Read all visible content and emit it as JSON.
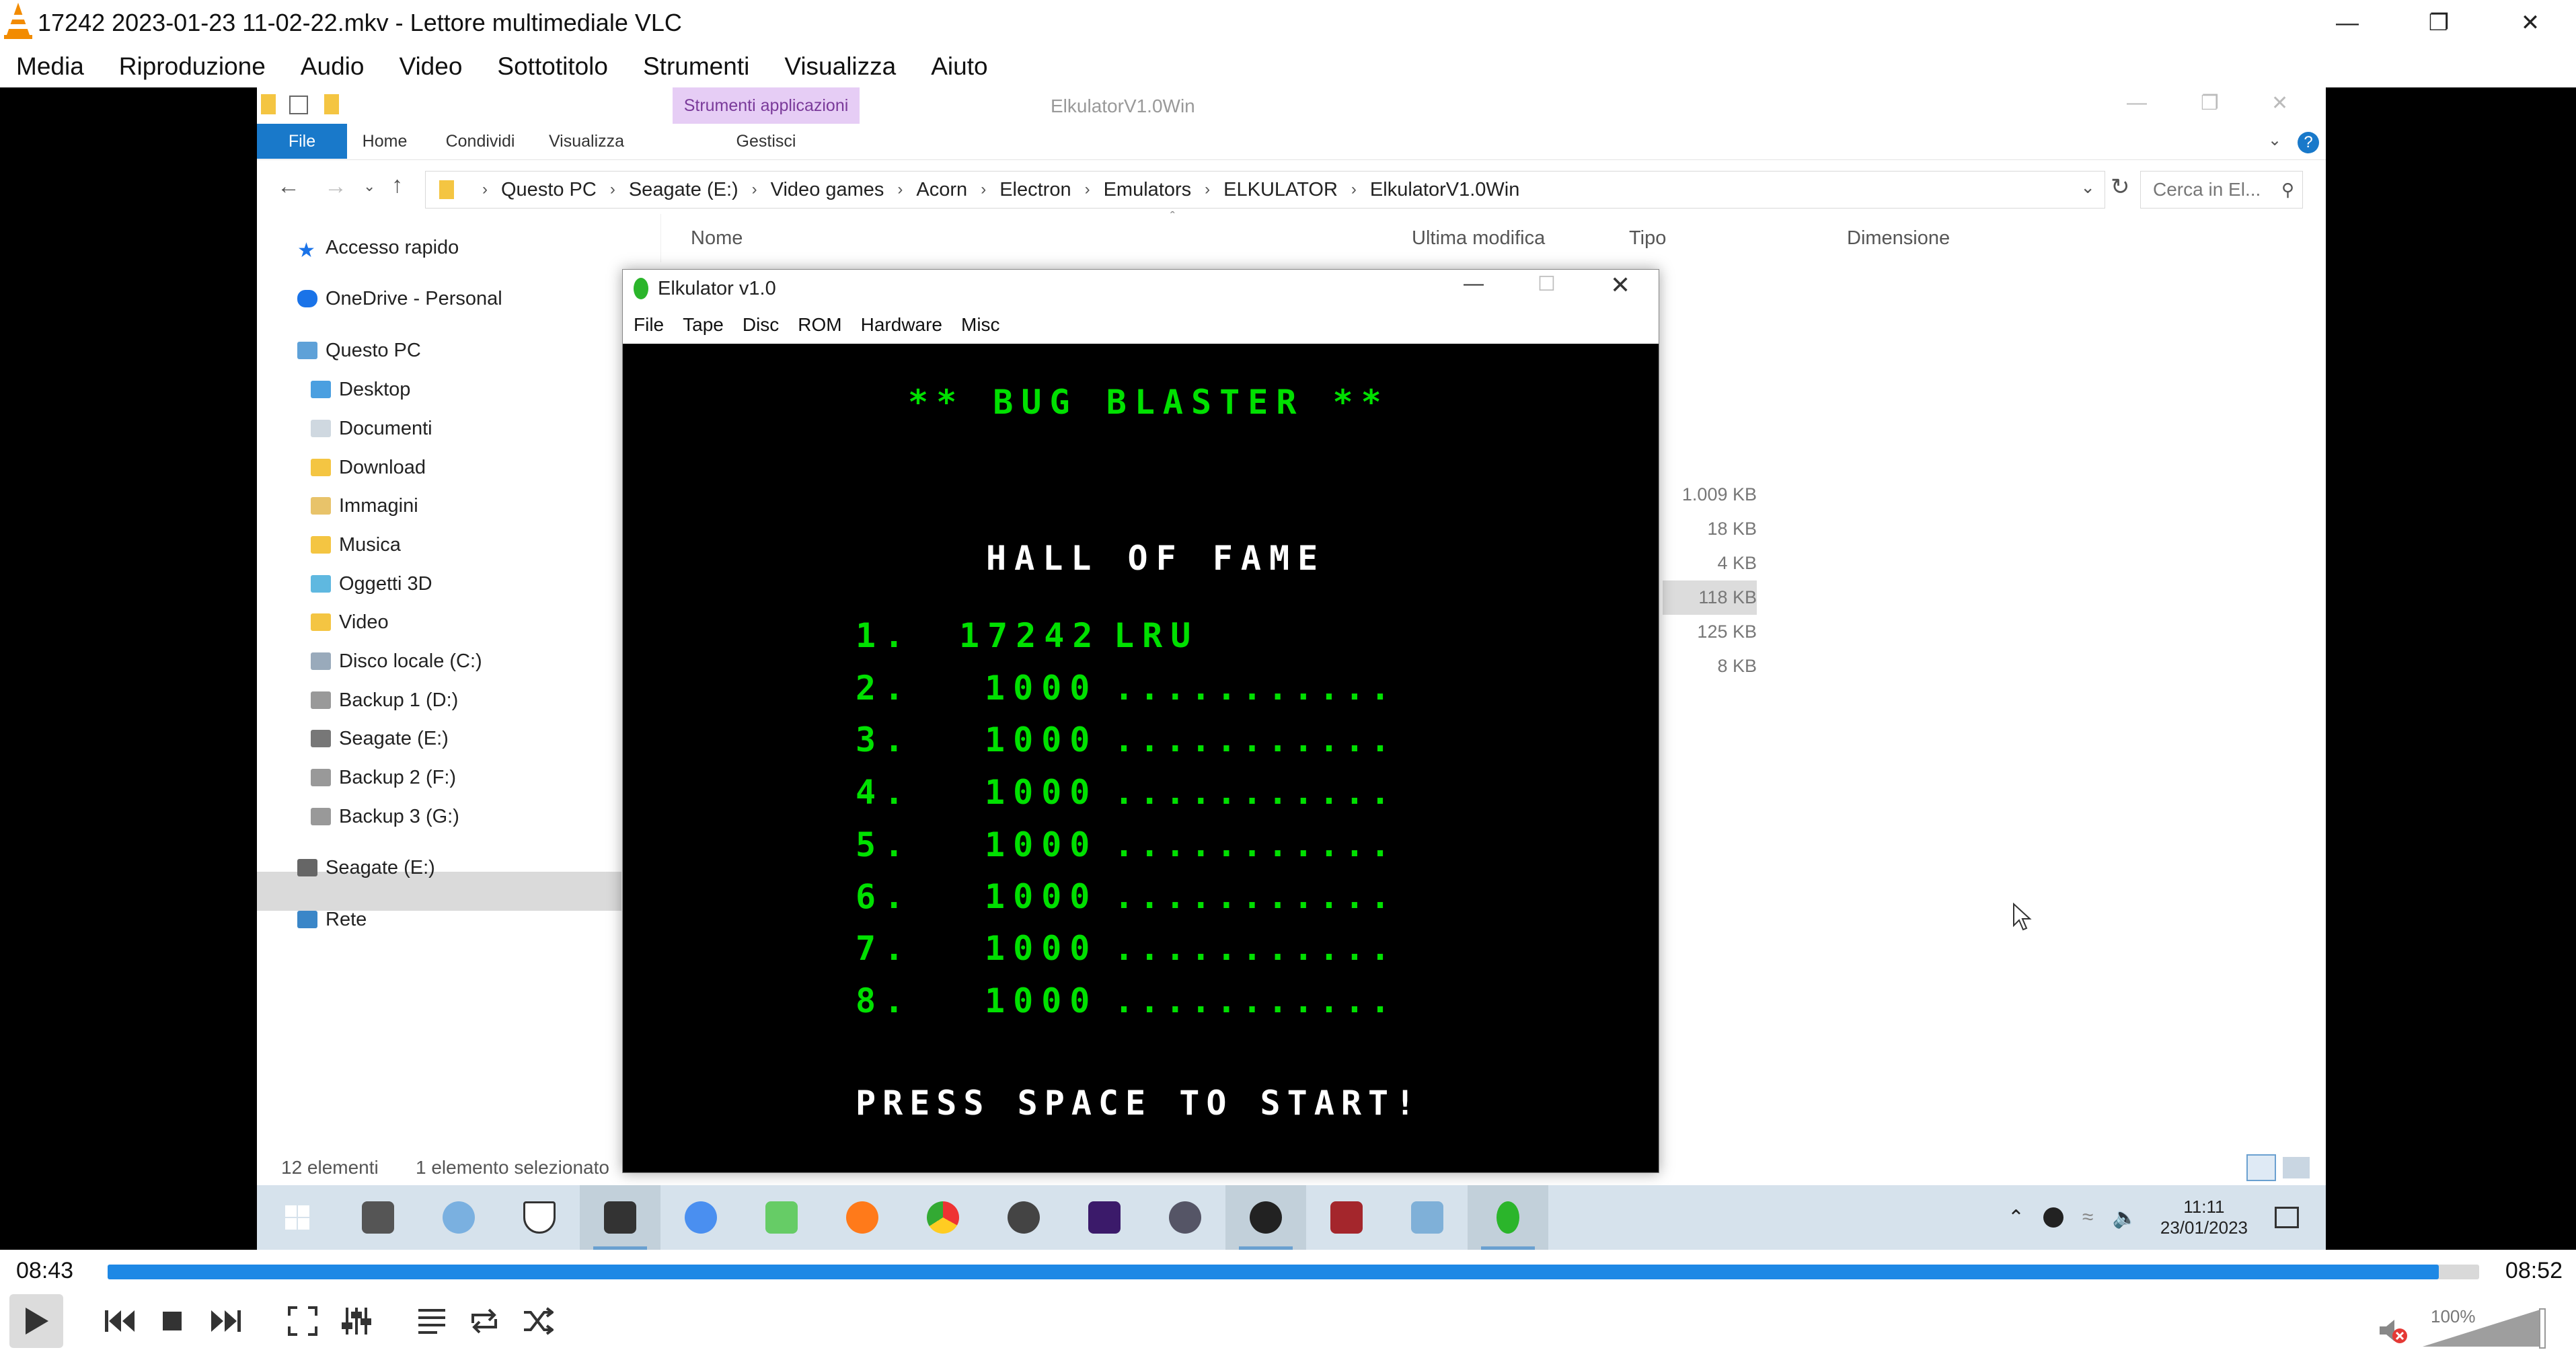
{
  "vlc": {
    "title": "17242 2023-01-23 11-02-22.mkv - Lettore multimediale VLC",
    "menu": [
      "Media",
      "Riproduzione",
      "Audio",
      "Video",
      "Sottotitolo",
      "Strumenti",
      "Visualizza",
      "Aiuto"
    ],
    "time_elapsed": "08:43",
    "time_total": "08:52",
    "progress": 0.983,
    "volume_label": "100%",
    "volume": 1.0
  },
  "explorer": {
    "window_title": "ElkulatorV1.0Win",
    "ribbon_tabs": [
      "File",
      "Home",
      "Condividi",
      "Visualizza"
    ],
    "context_group": "Strumenti applicazioni",
    "context_tab": "Gestisci",
    "breadcrumbs": [
      "Questo PC",
      "Seagate (E:)",
      "Video games",
      "Acorn",
      "Electron",
      "Emulators",
      "ELKULATOR",
      "ElkulatorV1.0Win"
    ],
    "search_placeholder": "Cerca in El...",
    "nav": {
      "quick": "Accesso rapido",
      "onedrive": "OneDrive - Personal",
      "pc": "Questo PC",
      "pc_items": [
        "Desktop",
        "Documenti",
        "Download",
        "Immagini",
        "Musica",
        "Oggetti 3D",
        "Video",
        "Disco locale (C:)",
        "Backup 1 (D:)",
        "Seagate (E:)",
        "Backup 2 (F:)",
        "Backup 3 (G:)"
      ],
      "seagate": "Seagate (E:)",
      "network": "Rete"
    },
    "columns": [
      "Nome",
      "Ultima modifica",
      "Tipo",
      "Dimensione"
    ],
    "sizes": [
      "1.009 KB",
      "18 KB",
      "4 KB",
      "118 KB",
      "125 KB",
      "8 KB"
    ],
    "status_count": "12 elementi",
    "status_selected": "1 elemento selezionato"
  },
  "elkulator": {
    "title": "Elkulator v1.0",
    "menu": [
      "File",
      "Tape",
      "Disc",
      "ROM",
      "Hardware",
      "Misc"
    ],
    "game": {
      "title": "** BUG BLASTER **",
      "subtitle": "HALL OF FAME",
      "scores": [
        {
          "rank": "1.",
          "score": "17242",
          "name": "LRU"
        },
        {
          "rank": "2.",
          "score": "1000",
          "name": "..........."
        },
        {
          "rank": "3.",
          "score": "1000",
          "name": "..........."
        },
        {
          "rank": "4.",
          "score": "1000",
          "name": "..........."
        },
        {
          "rank": "5.",
          "score": "1000",
          "name": "..........."
        },
        {
          "rank": "6.",
          "score": "1000",
          "name": "..........."
        },
        {
          "rank": "7.",
          "score": "1000",
          "name": "..........."
        },
        {
          "rank": "8.",
          "score": "1000",
          "name": "..........."
        }
      ],
      "prompt": "PRESS SPACE TO START!"
    }
  },
  "taskbar": {
    "time": "11:11",
    "date": "23/01/2023"
  }
}
